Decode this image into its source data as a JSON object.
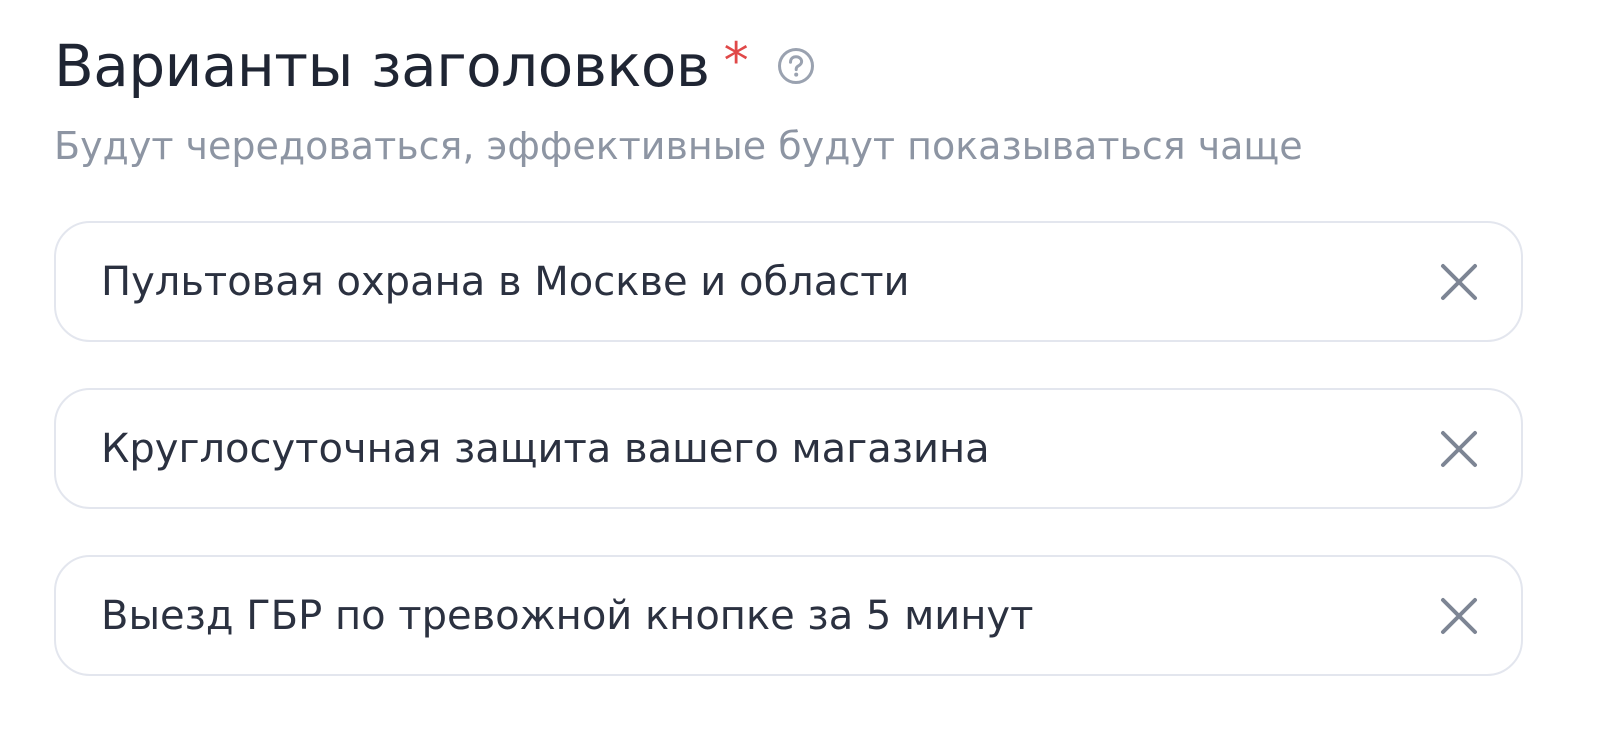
{
  "section": {
    "title": "Варианты заголовков",
    "required_mark": "*",
    "subtitle": "Будут чередоваться, эффективные будут показываться чаще",
    "help_icon": "question-circle-icon"
  },
  "headlines": [
    {
      "value": "Пультовая охрана в Москве и области",
      "clear_icon": "close-icon"
    },
    {
      "value": "Круглосуточная защита вашего магазина",
      "clear_icon": "close-icon"
    },
    {
      "value": "Выезд ГБР по тревожной кнопке за 5 минут",
      "clear_icon": "close-icon"
    }
  ],
  "colors": {
    "title": "#1f2533",
    "required": "#e04848",
    "subtitle": "#8d95a3",
    "field_border": "#e3e6ee",
    "field_text": "#2b3140",
    "icon": "#7d8594"
  }
}
